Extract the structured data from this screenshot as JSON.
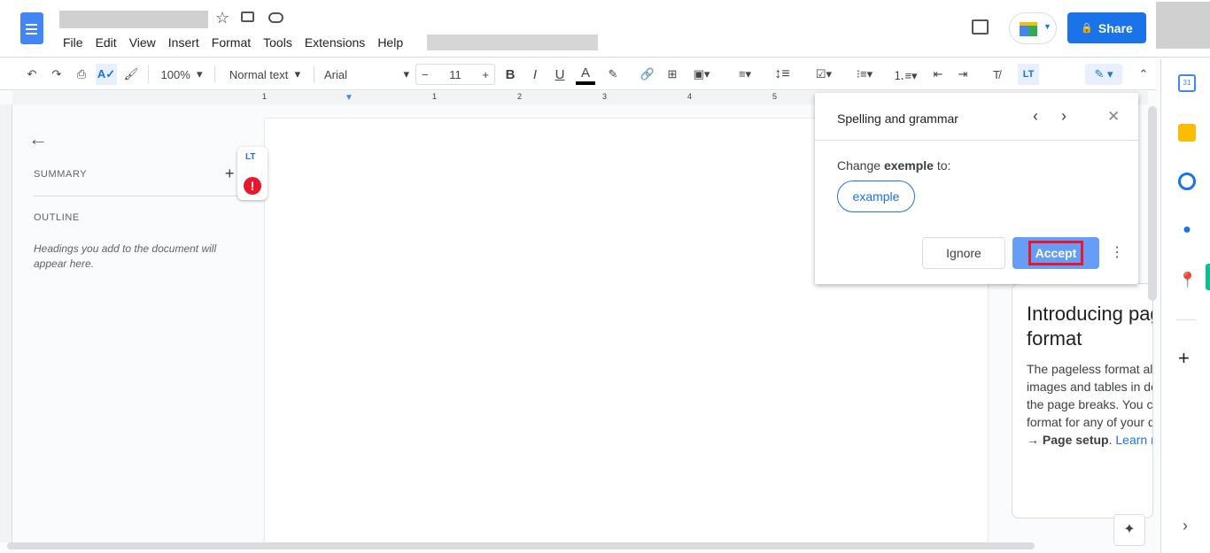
{
  "menu": [
    "File",
    "Edit",
    "View",
    "Insert",
    "Format",
    "Tools",
    "Extensions",
    "Help"
  ],
  "header": {
    "share_label": "Share"
  },
  "toolbar": {
    "zoom": "100%",
    "style": "Normal text",
    "font": "Arial",
    "font_size": "11"
  },
  "ruler": {
    "labels": [
      "1",
      "1",
      "2",
      "3",
      "4",
      "5"
    ]
  },
  "outline": {
    "summary": "SUMMARY",
    "outline": "OUTLINE",
    "hint": "Headings you add to the document will appear here."
  },
  "popup": {
    "title": "Spelling and grammar",
    "change_prefix": "Change ",
    "word": "exemple",
    "change_suffix": " to:",
    "suggestion": "example",
    "ignore": "Ignore",
    "accept": "Accept"
  },
  "card": {
    "title": "Introducing pageless format",
    "body": "The pageless format allows wide images and tables in documents without the page breaks. You can change the format for any of your documents in ",
    "bold": "File → Page setup",
    "link": "Learn more"
  },
  "colors": {
    "accent": "#1a73e8",
    "accept_bg": "#669df6",
    "highlight": "#e8172c"
  }
}
